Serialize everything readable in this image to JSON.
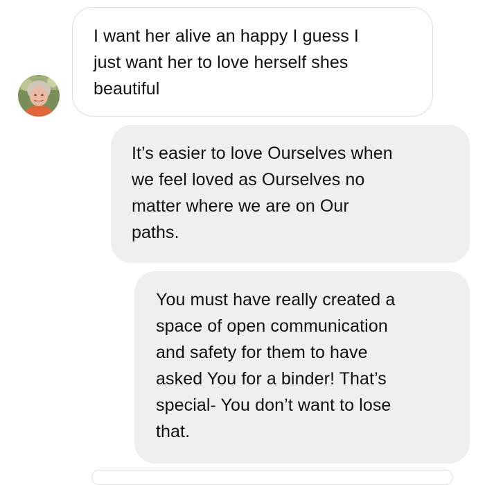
{
  "conversation": {
    "avatar_icon": "user-avatar-photo",
    "messages": [
      {
        "direction": "received",
        "lines": [
          "I want her alive an happy I guess I",
          "just want her to love herself shes",
          "beautiful"
        ]
      },
      {
        "direction": "sent",
        "lines": [
          "It’s easier to love Ourselves when",
          "we feel loved as Ourselves no",
          "matter where we are on Our",
          "paths."
        ]
      },
      {
        "direction": "sent",
        "lines": [
          "You must have really created a",
          "space of open communication",
          "and safety for them to have",
          "asked You for a binder! That’s",
          "special- You don’t want to lose",
          "that."
        ]
      }
    ]
  },
  "colors": {
    "received_bubble_bg": "#ffffff",
    "received_bubble_border": "#dedede",
    "sent_bubble_bg": "#efefef",
    "text": "#111111"
  }
}
